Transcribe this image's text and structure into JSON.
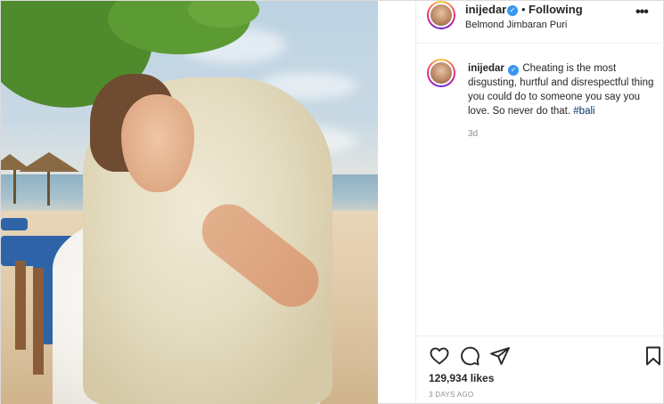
{
  "post": {
    "username": "inijedar",
    "separator": "•",
    "follow_label": "Following",
    "location": "Belmond Jimbaran Puri",
    "more_label": "•••"
  },
  "caption": {
    "username": "inijedar",
    "text": "Cheating is the most disgusting, hurtful and disrespectful thing you could do to someone you say you love. So never do that.",
    "hashtag": "#bali",
    "age": "3d"
  },
  "footer": {
    "likes": "129,934 likes",
    "posted": "3 DAYS AGO"
  },
  "icons": {
    "like": "heart-icon",
    "comment": "comment-icon",
    "share": "paper-plane-icon",
    "save": "bookmark-icon",
    "verified": "verified-badge-icon"
  },
  "colors": {
    "verified": "#3897f0",
    "hashtag": "#00376b",
    "muted": "#8e8e8e"
  }
}
